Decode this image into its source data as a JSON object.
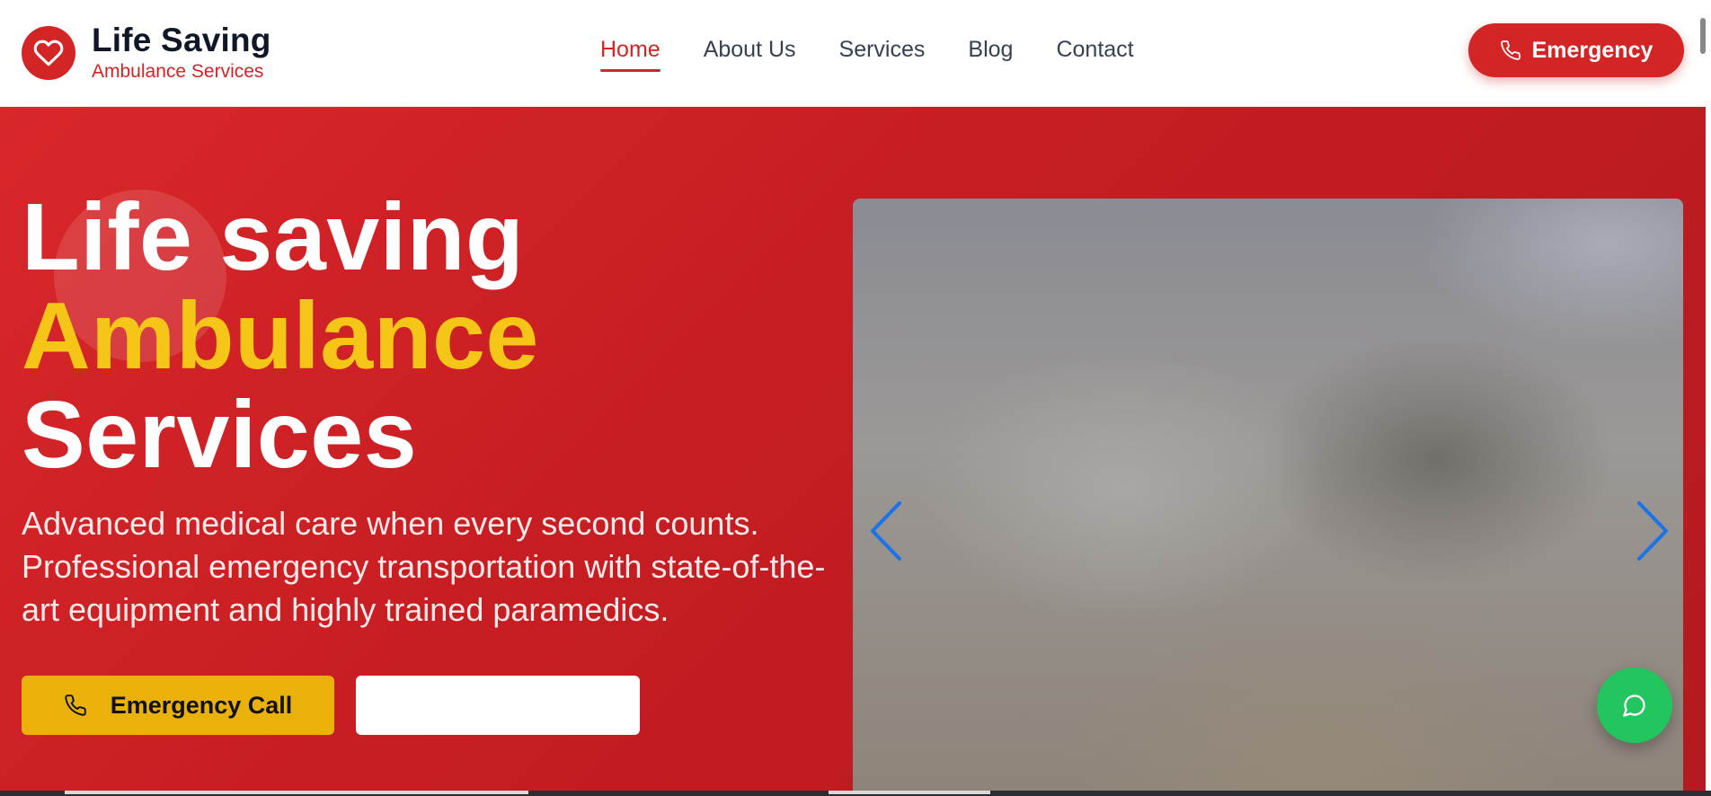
{
  "brand": {
    "title": "Life Saving",
    "subtitle": "Ambulance Services",
    "icon": "heart-icon",
    "color": "#d32426"
  },
  "nav": {
    "items": [
      {
        "label": "Home",
        "active": true
      },
      {
        "label": "About Us",
        "active": false
      },
      {
        "label": "Services",
        "active": false
      },
      {
        "label": "Blog",
        "active": false
      },
      {
        "label": "Contact",
        "active": false
      }
    ]
  },
  "header_cta": {
    "label": "Emergency",
    "icon": "phone-icon"
  },
  "hero": {
    "title_line1": "Life saving",
    "title_line2": "Ambulance",
    "title_line3": "Services",
    "description": "Advanced medical care when every second counts. Professional emergency transportation with state-of-the-art equipment and highly trained paramedics.",
    "primary_button": "Emergency Call",
    "primary_icon": "phone-icon",
    "secondary_button": "",
    "accent_color": "#f5c518",
    "background_color": "#c51d22"
  },
  "slider": {
    "prev_icon": "chevron-left-icon",
    "next_icon": "chevron-right-icon",
    "arrow_color": "#1a73e8"
  },
  "chat": {
    "icon": "chat-bubble-icon",
    "color": "#22c55e"
  }
}
